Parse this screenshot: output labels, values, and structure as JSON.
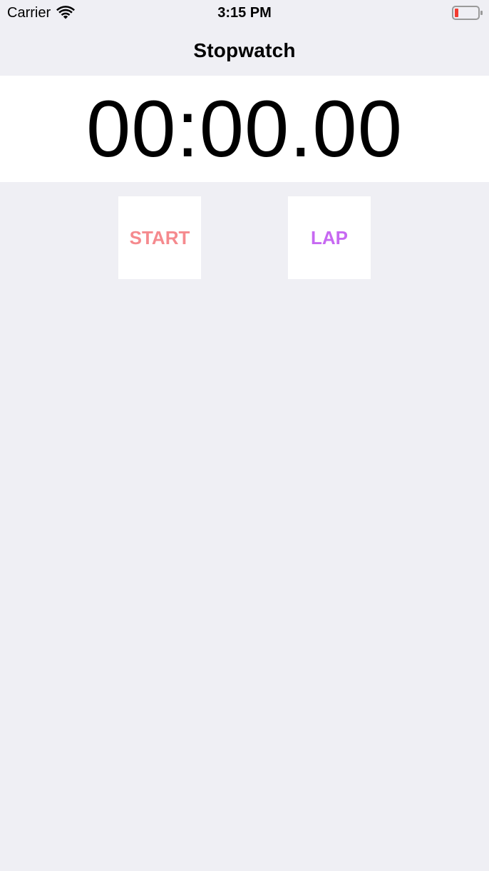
{
  "status_bar": {
    "carrier": "Carrier",
    "time": "3:15 PM",
    "icons": [
      "wifi-icon",
      "battery-icon"
    ],
    "battery_color": "#f23b30"
  },
  "nav_bar": {
    "title": "Stopwatch"
  },
  "timer": {
    "display": "00:00.00"
  },
  "controls": {
    "start_label": "START",
    "start_color": "#f58a8e",
    "lap_label": "LAP",
    "lap_color": "#c769f2"
  },
  "colors": {
    "background": "#efeff4",
    "panel": "#ffffff"
  }
}
